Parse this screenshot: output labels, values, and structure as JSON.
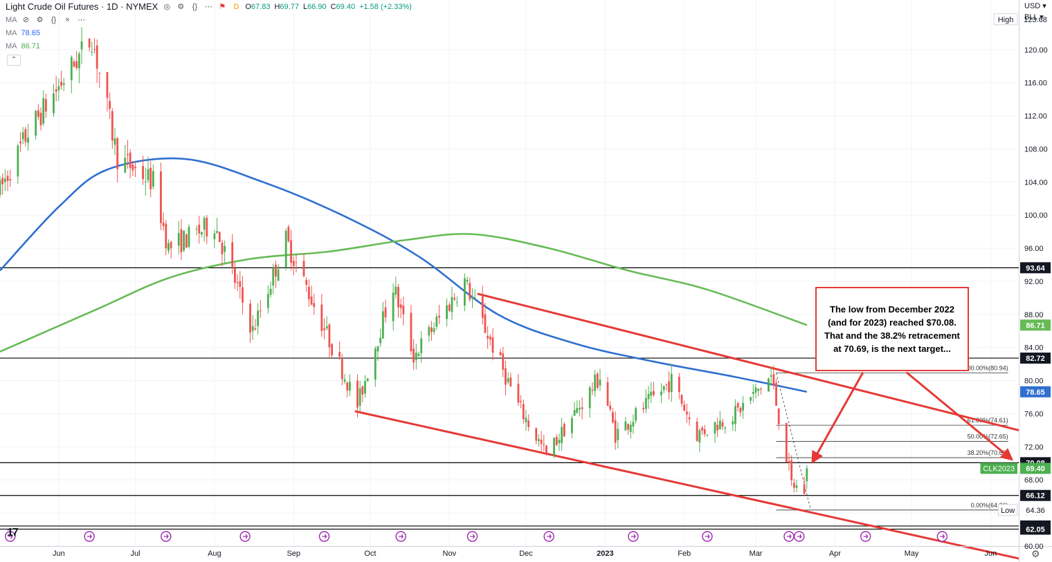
{
  "legend": {
    "title": "Light Crude Oil Futures · 1D · NYMEX",
    "o_label": "O",
    "o_value": "67.83",
    "h_label": "H",
    "h_value": "69.77",
    "l_label": "L",
    "l_value": "66.90",
    "c_label": "C",
    "c_value": "69.40",
    "change": "+1.58 (+2.33%)",
    "ma1_label": "MA",
    "ma1_value": "78.65",
    "ma2_label": "MA",
    "ma2_value": "86.71",
    "collapse_icon": "chevron-up-icon",
    "d_badge": "D"
  },
  "currency": {
    "ccy": "USD",
    "unit": "BLL"
  },
  "annotation": {
    "text": "The low from December 2022 (and for 2023) reached $70.08. That and the 38.2% retracement at 70.69, is the next target..."
  },
  "chart_data": {
    "type": "candlestick",
    "title": "Light Crude Oil Futures · 1D · NYMEX",
    "ylim": [
      60,
      126
    ],
    "y_ticks": [
      60,
      64,
      68,
      72,
      76,
      80,
      84,
      88,
      92,
      96,
      100,
      104,
      108,
      112,
      116,
      120
    ],
    "y_tick_labels": [
      "60.00",
      "64.00",
      "68.00",
      "72.00",
      "76.00",
      "80.00",
      "84.00",
      "88.00",
      "92.00",
      "96.00",
      "100.00",
      "104.00",
      "108.00",
      "112.00",
      "116.00",
      "120.00"
    ],
    "x_labels": [
      "Jun",
      "Jul",
      "Aug",
      "Sep",
      "Oct",
      "Nov",
      "Dec",
      "2023",
      "Feb",
      "Mar",
      "Apr",
      "May",
      "Jun"
    ],
    "x_label_dates": [
      "2022-06-01",
      "2022-07-01",
      "2022-08-01",
      "2022-09-01",
      "2022-10-01",
      "2022-11-01",
      "2022-12-01",
      "2023-01-01",
      "2023-02-01",
      "2023-03-01",
      "2023-04-01",
      "2023-05-01",
      "2023-06-01"
    ],
    "x_domain": [
      "2022-05-09",
      "2023-06-12"
    ],
    "grid": true,
    "price_key_points": [
      {
        "date": "2022-05-09",
        "price": 103
      },
      {
        "date": "2022-05-20",
        "price": 110
      },
      {
        "date": "2022-06-14",
        "price": 121.5
      },
      {
        "date": "2022-06-24",
        "price": 107
      },
      {
        "date": "2022-07-08",
        "price": 104
      },
      {
        "date": "2022-07-14",
        "price": 96
      },
      {
        "date": "2022-08-01",
        "price": 99
      },
      {
        "date": "2022-08-16",
        "price": 86
      },
      {
        "date": "2022-08-29",
        "price": 97
      },
      {
        "date": "2022-09-26",
        "price": 77
      },
      {
        "date": "2022-10-10",
        "price": 91.5
      },
      {
        "date": "2022-10-18",
        "price": 83
      },
      {
        "date": "2022-11-07",
        "price": 92
      },
      {
        "date": "2022-11-28",
        "price": 77
      },
      {
        "date": "2022-12-09",
        "price": 71
      },
      {
        "date": "2022-12-30",
        "price": 80.5
      },
      {
        "date": "2023-01-05",
        "price": 73.5
      },
      {
        "date": "2023-01-27",
        "price": 80
      },
      {
        "date": "2023-02-06",
        "price": 73.5
      },
      {
        "date": "2023-02-21",
        "price": 76
      },
      {
        "date": "2023-03-07",
        "price": 80.5
      },
      {
        "date": "2023-03-15",
        "price": 67.5
      },
      {
        "date": "2023-03-20",
        "price": 66.6
      },
      {
        "date": "2023-03-21",
        "price": 69.4
      }
    ],
    "last_candle": {
      "date": "2023-03-21",
      "open": 67.83,
      "high": 69.77,
      "low": 66.9,
      "close": 69.4
    },
    "series": [
      {
        "name": "MA",
        "color": "#2f6fd0",
        "last_value": 78.65,
        "points": [
          {
            "date": "2022-05-09",
            "price": 93.3
          },
          {
            "date": "2022-06-01",
            "price": 101
          },
          {
            "date": "2022-06-20",
            "price": 105.5
          },
          {
            "date": "2022-07-20",
            "price": 106.8
          },
          {
            "date": "2022-08-20",
            "price": 104
          },
          {
            "date": "2022-09-20",
            "price": 100
          },
          {
            "date": "2022-10-20",
            "price": 95
          },
          {
            "date": "2022-11-20",
            "price": 88
          },
          {
            "date": "2022-12-20",
            "price": 84.5
          },
          {
            "date": "2023-01-20",
            "price": 82.3
          },
          {
            "date": "2023-02-20",
            "price": 80.5
          },
          {
            "date": "2023-03-21",
            "price": 78.65
          }
        ]
      },
      {
        "name": "MA",
        "color": "#66bb55",
        "last_value": 86.71,
        "points": [
          {
            "date": "2022-05-09",
            "price": 83.5
          },
          {
            "date": "2022-06-15",
            "price": 88.5
          },
          {
            "date": "2022-07-15",
            "price": 92.5
          },
          {
            "date": "2022-08-15",
            "price": 94.7
          },
          {
            "date": "2022-09-15",
            "price": 95.6
          },
          {
            "date": "2022-10-15",
            "price": 97
          },
          {
            "date": "2022-11-10",
            "price": 97.7
          },
          {
            "date": "2022-12-10",
            "price": 96
          },
          {
            "date": "2023-01-10",
            "price": 93.3
          },
          {
            "date": "2023-02-10",
            "price": 91
          },
          {
            "date": "2023-03-21",
            "price": 86.71
          }
        ]
      }
    ],
    "horizontal_lines": [
      93.64,
      82.72,
      70.08,
      66.12,
      62.43,
      62.05
    ],
    "trendlines": [
      {
        "start": {
          "date": "2022-11-12",
          "price": 90.5
        },
        "end": {
          "date": "2023-06-12",
          "price": 74
        }
      },
      {
        "start": {
          "date": "2022-09-25",
          "price": 76.3
        },
        "end": {
          "date": "2023-06-12",
          "price": 58.5
        }
      }
    ],
    "fib_levels": [
      {
        "label": "100.00%(80.94)",
        "price": 80.94
      },
      {
        "label": "61.80%(74.61)",
        "price": 74.61
      },
      {
        "label": "50.00%(72.65)",
        "price": 72.65
      },
      {
        "label": "38.20%(70.69)",
        "price": 70.69
      },
      {
        "label": "0.00%(64.36)",
        "price": 64.36
      }
    ],
    "axis_badges": [
      {
        "label": "High",
        "value": "123.68",
        "price": 123.68,
        "style": "plain"
      },
      {
        "label": "",
        "value": "93.64",
        "price": 93.64,
        "style": "black"
      },
      {
        "label": "",
        "value": "86.71",
        "price": 86.71,
        "style": "green"
      },
      {
        "label": "",
        "value": "82.72",
        "price": 82.72,
        "style": "black"
      },
      {
        "label": "",
        "value": "78.65",
        "price": 78.65,
        "style": "blue"
      },
      {
        "label": "",
        "value": "70.08",
        "price": 70.08,
        "style": "black"
      },
      {
        "label": "CLK2023",
        "value": "69.40",
        "price": 69.4,
        "style": "teal"
      },
      {
        "label": "",
        "value": "66.12",
        "price": 66.12,
        "style": "black"
      },
      {
        "label": "Low",
        "value": "64.36",
        "price": 64.36,
        "style": "plain"
      },
      {
        "label": "",
        "value": "62.43",
        "price": 62.43,
        "style": "black"
      },
      {
        "label": "",
        "value": "62.05",
        "price": 62.05,
        "style": "black"
      }
    ],
    "arrows": [
      {
        "from_date": "2023-04-12",
        "from_price": 81,
        "to_date": "2023-03-24",
        "to_price": 70.6
      },
      {
        "from_date": "2023-04-29",
        "from_price": 81,
        "to_date": "2023-06-08",
        "to_price": 70.8
      }
    ]
  }
}
